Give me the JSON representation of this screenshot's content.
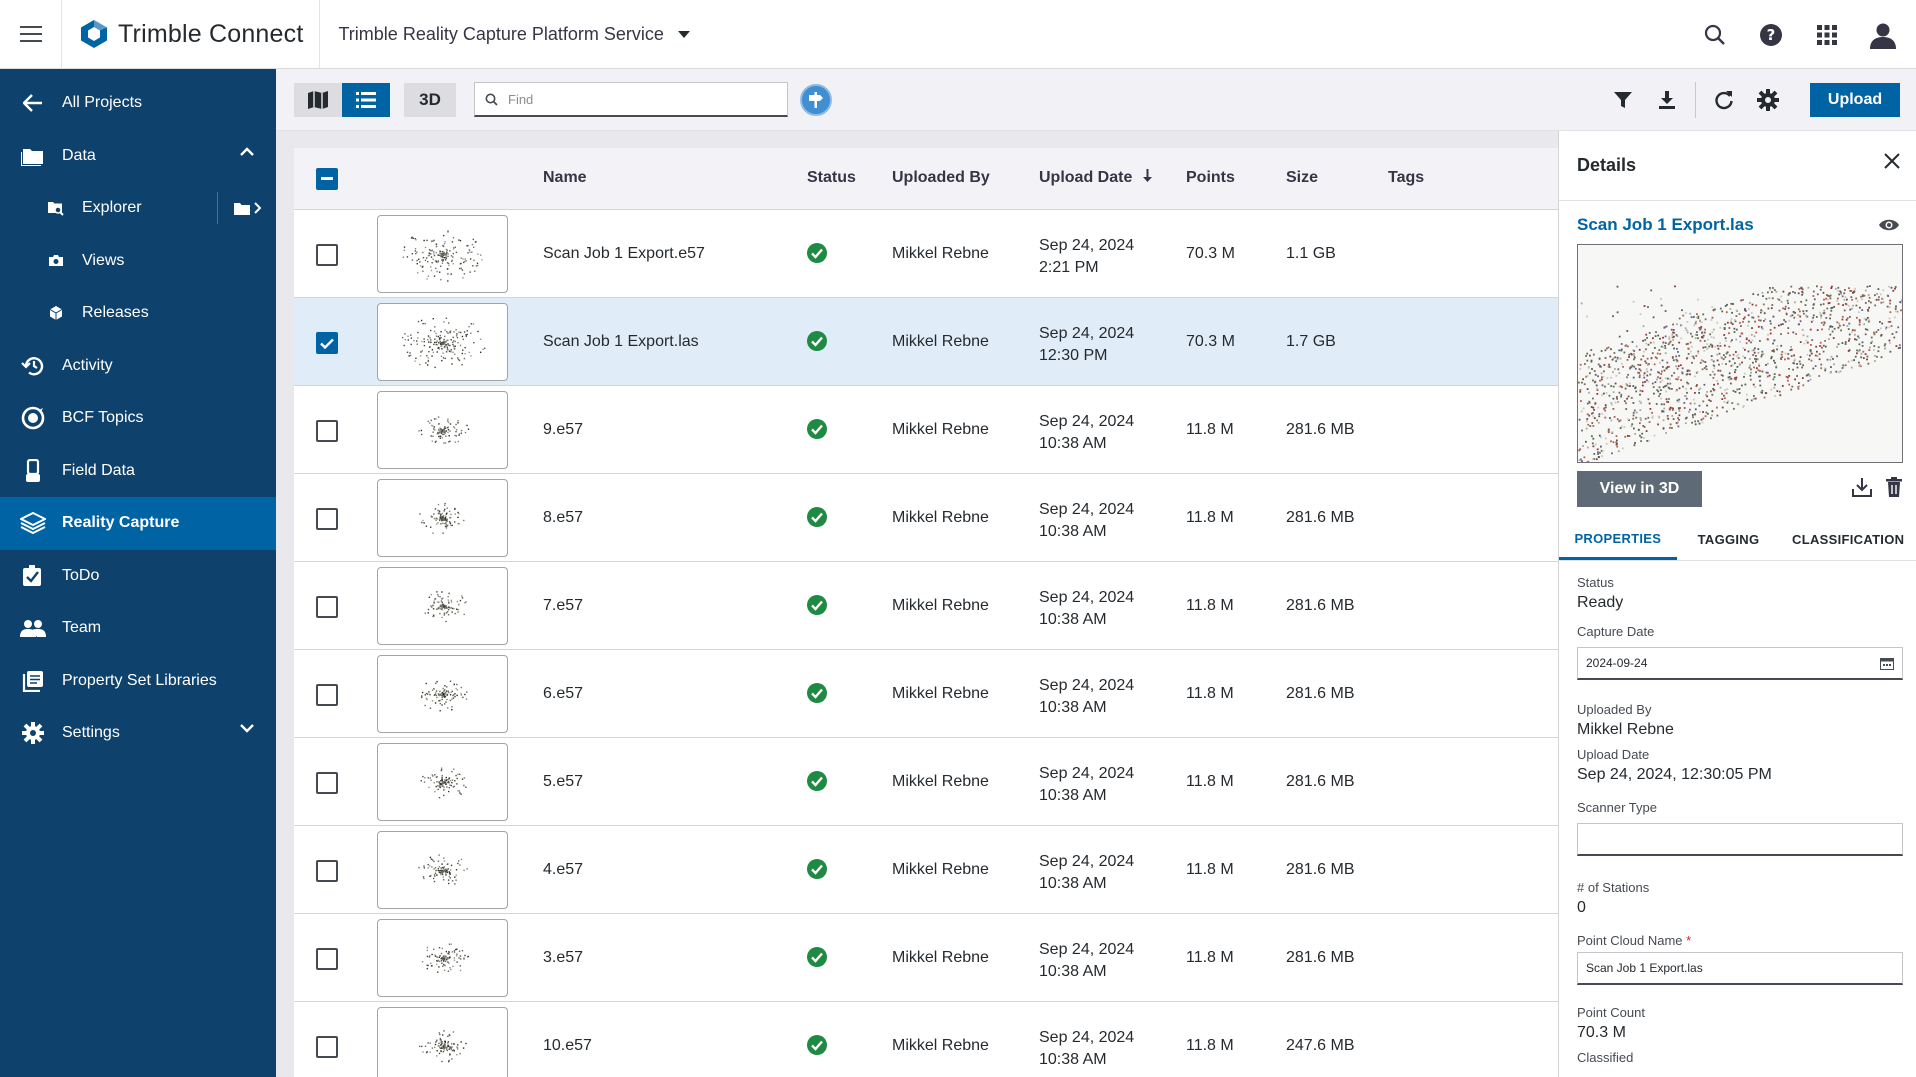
{
  "topbar": {
    "brand": "Trimble Connect",
    "service": "Trimble Reality Capture Platform Service"
  },
  "sidebar": {
    "items": [
      {
        "label": "All Projects",
        "icon": "arrow-left-icon"
      },
      {
        "label": "Data",
        "icon": "folder-icon"
      },
      {
        "label": "Explorer",
        "icon": "folder-search-icon"
      },
      {
        "label": "Views",
        "icon": "camera-icon"
      },
      {
        "label": "Releases",
        "icon": "cube-icon"
      },
      {
        "label": "Activity",
        "icon": "history-icon"
      },
      {
        "label": "BCF Topics",
        "icon": "bcf-icon"
      },
      {
        "label": "Field Data",
        "icon": "field-data-icon"
      },
      {
        "label": "Reality Capture",
        "icon": "reality-capture-icon"
      },
      {
        "label": "ToDo",
        "icon": "checkbox-icon"
      },
      {
        "label": "Team",
        "icon": "team-icon"
      },
      {
        "label": "Property Set Libraries",
        "icon": "library-icon"
      },
      {
        "label": "Settings",
        "icon": "gear-icon"
      }
    ]
  },
  "toolbar": {
    "btn_3d": "3D",
    "find_placeholder": "Find",
    "upload_label": "Upload"
  },
  "table": {
    "headers": {
      "name": "Name",
      "status": "Status",
      "uploaded_by": "Uploaded By",
      "upload_date": "Upload Date",
      "points": "Points",
      "size": "Size",
      "tags": "Tags"
    },
    "rows": [
      {
        "name": "Scan Job 1 Export.e57",
        "uploaded_by": "Mikkel Rebne",
        "date": "Sep 24, 2024",
        "time": "2:21 PM",
        "points": "70.3 M",
        "size": "1.1 GB",
        "selected": false
      },
      {
        "name": "Scan Job 1 Export.las",
        "uploaded_by": "Mikkel Rebne",
        "date": "Sep 24, 2024",
        "time": "12:30 PM",
        "points": "70.3 M",
        "size": "1.7 GB",
        "selected": true
      },
      {
        "name": "9.e57",
        "uploaded_by": "Mikkel Rebne",
        "date": "Sep 24, 2024",
        "time": "10:38 AM",
        "points": "11.8 M",
        "size": "281.6 MB",
        "selected": false
      },
      {
        "name": "8.e57",
        "uploaded_by": "Mikkel Rebne",
        "date": "Sep 24, 2024",
        "time": "10:38 AM",
        "points": "11.8 M",
        "size": "281.6 MB",
        "selected": false
      },
      {
        "name": "7.e57",
        "uploaded_by": "Mikkel Rebne",
        "date": "Sep 24, 2024",
        "time": "10:38 AM",
        "points": "11.8 M",
        "size": "281.6 MB",
        "selected": false
      },
      {
        "name": "6.e57",
        "uploaded_by": "Mikkel Rebne",
        "date": "Sep 24, 2024",
        "time": "10:38 AM",
        "points": "11.8 M",
        "size": "281.6 MB",
        "selected": false
      },
      {
        "name": "5.e57",
        "uploaded_by": "Mikkel Rebne",
        "date": "Sep 24, 2024",
        "time": "10:38 AM",
        "points": "11.8 M",
        "size": "281.6 MB",
        "selected": false
      },
      {
        "name": "4.e57",
        "uploaded_by": "Mikkel Rebne",
        "date": "Sep 24, 2024",
        "time": "10:38 AM",
        "points": "11.8 M",
        "size": "281.6 MB",
        "selected": false
      },
      {
        "name": "3.e57",
        "uploaded_by": "Mikkel Rebne",
        "date": "Sep 24, 2024",
        "time": "10:38 AM",
        "points": "11.8 M",
        "size": "281.6 MB",
        "selected": false
      },
      {
        "name": "10.e57",
        "uploaded_by": "Mikkel Rebne",
        "date": "Sep 24, 2024",
        "time": "10:38 AM",
        "points": "11.8 M",
        "size": "247.6 MB",
        "selected": false
      }
    ]
  },
  "details": {
    "title": "Details",
    "file_name": "Scan Job 1 Export.las",
    "view_3d": "View in 3D",
    "tabs": [
      "PROPERTIES",
      "TAGGING",
      "CLASSIFICATION"
    ],
    "properties": {
      "status_label": "Status",
      "status_value": "Ready",
      "capture_date_label": "Capture Date",
      "capture_date_value": "2024-09-24",
      "uploaded_by_label": "Uploaded By",
      "uploaded_by_value": "Mikkel Rebne",
      "upload_date_label": "Upload Date",
      "upload_date_value": "Sep 24, 2024, 12:30:05 PM",
      "scanner_type_label": "Scanner Type",
      "scanner_type_value": "",
      "stations_label": "# of Stations",
      "stations_value": "0",
      "point_cloud_name_label": "Point Cloud Name",
      "point_cloud_name_value": "Scan Job 1 Export.las",
      "point_count_label": "Point Count",
      "point_count_value": "70.3 M",
      "classified_label": "Classified"
    }
  },
  "colors": {
    "sidebar_bg": "#0e416c",
    "active_nav": "#0063a3",
    "primary": "#0063a3",
    "status_ok": "#1e8a44"
  }
}
